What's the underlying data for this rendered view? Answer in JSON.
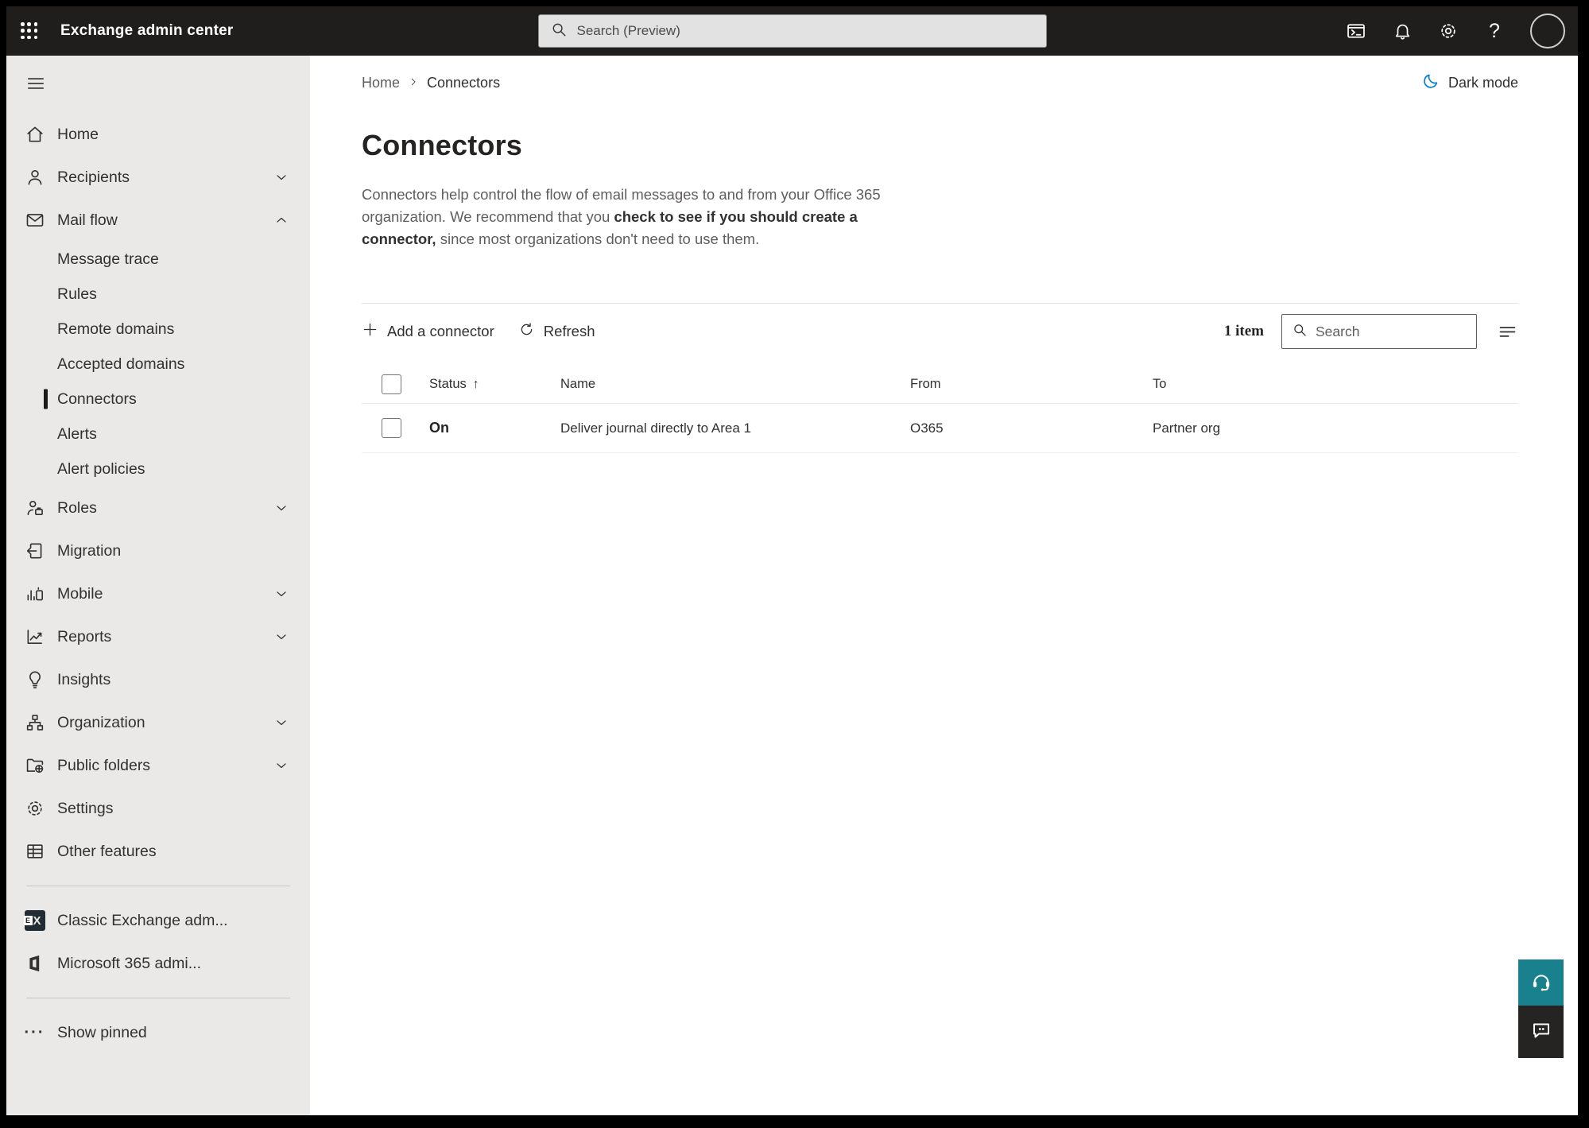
{
  "topbar": {
    "app_title": "Exchange admin center",
    "search_placeholder": "Search (Preview)",
    "help_glyph": "?"
  },
  "breadcrumb": {
    "home": "Home",
    "current": "Connectors"
  },
  "dark_mode_label": "Dark mode",
  "page": {
    "title": "Connectors",
    "description_part1": "Connectors help control the flow of email messages to and from your Office 365 organization. We recommend that you ",
    "description_link": "check to see if you should create a connector,",
    "description_part2": " since most organizations don't need to use them."
  },
  "toolbar": {
    "add_label": "Add a connector",
    "refresh_label": "Refresh",
    "item_count": "1 item",
    "search_placeholder": "Search"
  },
  "table": {
    "sort_arrow": "↑",
    "headers": {
      "status": "Status",
      "name": "Name",
      "from": "From",
      "to": "To"
    },
    "rows": [
      {
        "status": "On",
        "name": "Deliver journal directly to Area 1",
        "from": "O365",
        "to": "Partner org"
      }
    ]
  },
  "sidebar": {
    "items": [
      {
        "label": "Home",
        "icon": "home-icon"
      },
      {
        "label": "Recipients",
        "icon": "person-icon",
        "chevron": "down"
      },
      {
        "label": "Mail flow",
        "icon": "mail-icon",
        "chevron": "up",
        "expanded": true
      },
      {
        "label": "Message trace",
        "child": true
      },
      {
        "label": "Rules",
        "child": true
      },
      {
        "label": "Remote domains",
        "child": true
      },
      {
        "label": "Accepted domains",
        "child": true
      },
      {
        "label": "Connectors",
        "child": true,
        "selected": true
      },
      {
        "label": "Alerts",
        "child": true
      },
      {
        "label": "Alert policies",
        "child": true
      },
      {
        "label": "Roles",
        "icon": "person-roles-icon",
        "chevron": "down"
      },
      {
        "label": "Migration",
        "icon": "migration-icon"
      },
      {
        "label": "Mobile",
        "icon": "mobile-icon",
        "chevron": "down"
      },
      {
        "label": "Reports",
        "icon": "reports-icon",
        "chevron": "down"
      },
      {
        "label": "Insights",
        "icon": "lightbulb-icon"
      },
      {
        "label": "Organization",
        "icon": "org-chart-icon",
        "chevron": "down"
      },
      {
        "label": "Public folders",
        "icon": "folder-globe-icon",
        "chevron": "down"
      },
      {
        "label": "Settings",
        "icon": "gear-icon"
      },
      {
        "label": "Other features",
        "icon": "grid-table-icon"
      }
    ],
    "footer_items": [
      {
        "label": "Classic Exchange adm...",
        "icon": "exchange-logo-icon",
        "badge_letter": "E",
        "x_mark": "X"
      },
      {
        "label": "Microsoft 365 admi...",
        "icon": "microsoft-365-logo-icon"
      }
    ],
    "show_pinned_label": "Show pinned",
    "ellipsis_glyph": "···"
  },
  "colors": {
    "accent_blue": "#0078d4",
    "help_teal": "#19808e",
    "topbar_black": "#1f1e1d",
    "sidebar_grey": "#eae9e8"
  }
}
